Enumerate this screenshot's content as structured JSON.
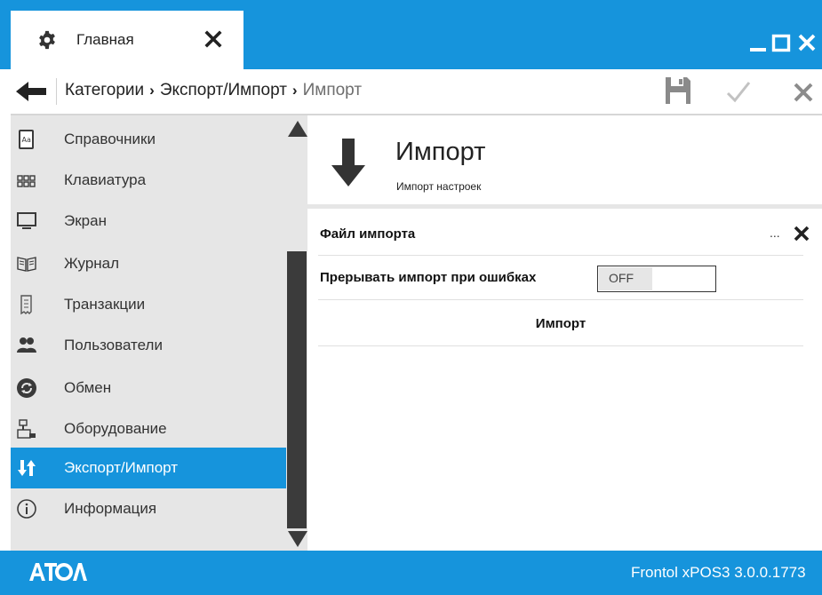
{
  "window": {
    "tab_label": "Главная",
    "controls": [
      "minimize",
      "maximize",
      "close"
    ]
  },
  "breadcrumb": {
    "items": [
      "Категории",
      "Экспорт/Импорт"
    ],
    "current": "Импорт",
    "separator": "›"
  },
  "sidebar": {
    "items": [
      {
        "label": "Справочники",
        "icon": "book-icon"
      },
      {
        "label": "Клавиатура",
        "icon": "keyboard-icon"
      },
      {
        "label": "Экран",
        "icon": "monitor-icon"
      },
      {
        "label": "Журнал",
        "icon": "journal-icon"
      },
      {
        "label": "Транзакции",
        "icon": "receipt-icon"
      },
      {
        "label": "Пользователи",
        "icon": "users-icon"
      },
      {
        "label": "Обмен",
        "icon": "sync-icon"
      },
      {
        "label": "Оборудование",
        "icon": "cash-register-icon"
      },
      {
        "label": "Экспорт/Импорт",
        "icon": "export-import-icon",
        "active": true
      },
      {
        "label": "Информация",
        "icon": "info-icon"
      }
    ]
  },
  "main": {
    "title": "Импорт",
    "subtitle": "Импорт настроек",
    "file_label": "Файл импорта",
    "file_browse": "...",
    "abort_label": "Прерывать импорт при ошибках",
    "abort_toggle": "OFF",
    "import_button": "Импорт"
  },
  "footer": {
    "logo_text": "АТОЛ",
    "version": "Frontol xPOS3 3.0.0.1773"
  },
  "colors": {
    "accent": "#1694dc",
    "sidebar_bg": "#e6e6e6",
    "scroll_thumb": "#3b3b3b"
  }
}
